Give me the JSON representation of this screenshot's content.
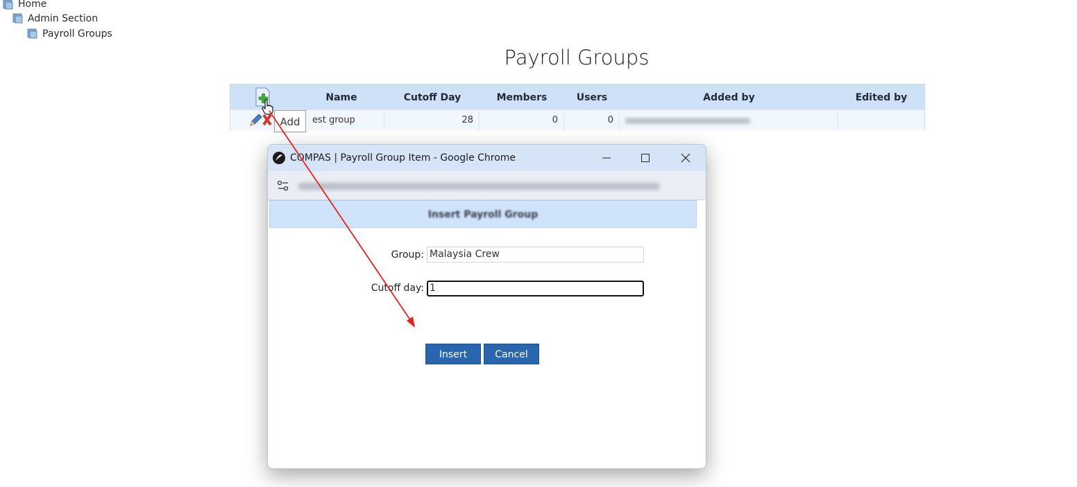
{
  "breadcrumb": [
    {
      "label": "Home"
    },
    {
      "label": "Admin Section"
    },
    {
      "label": "Payroll Groups"
    }
  ],
  "page": {
    "title": "Payroll Groups"
  },
  "grid": {
    "columns": [
      "Name",
      "Cutoff Day",
      "Members",
      "Users",
      "Added by",
      "Edited by"
    ],
    "rows": [
      {
        "name": "est group",
        "cutoff_day": "28",
        "members": "0",
        "users": "0",
        "added_by": "",
        "edited_by": ""
      }
    ],
    "add_tooltip": "Add"
  },
  "popup": {
    "window_title": "COMPAS | Payroll Group Item - Google Chrome",
    "form_header": "Insert Payroll Group",
    "group_label": "Group:",
    "group_value": "Malaysia Crew",
    "cutoff_label": "Cutoff day:",
    "cutoff_value": "1",
    "insert_label": "Insert",
    "cancel_label": "Cancel"
  },
  "colors": {
    "header_bg": "#cfe1f7",
    "button_bg": "#2a66ad",
    "annotation_arrow": "#e8201c"
  }
}
